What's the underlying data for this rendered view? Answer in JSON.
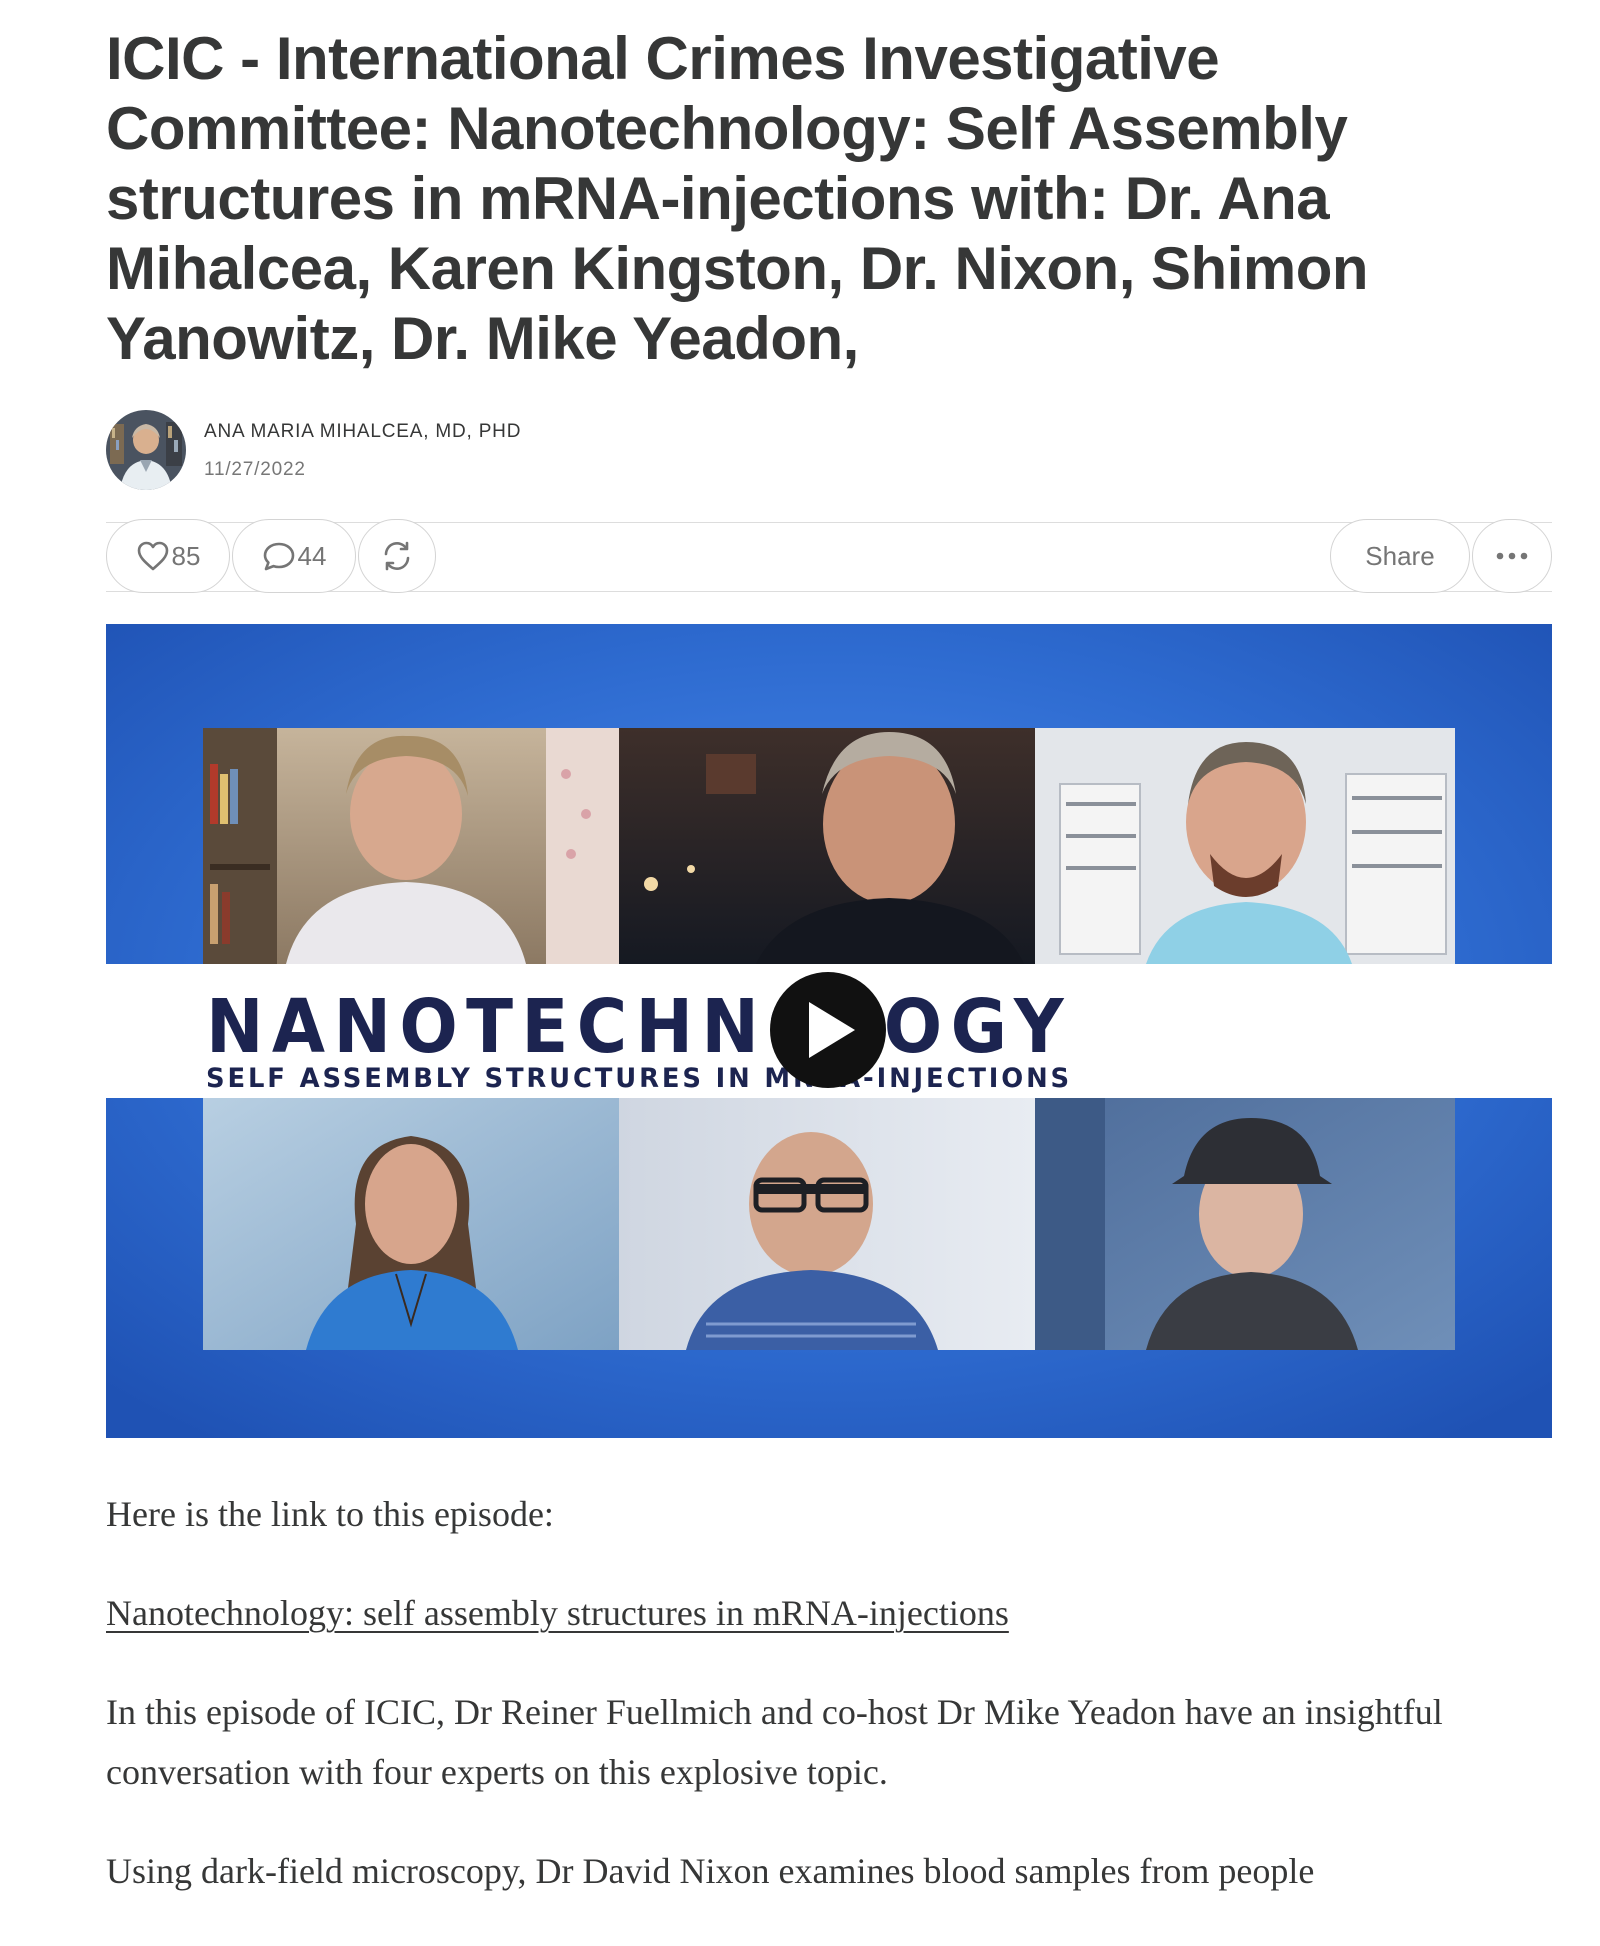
{
  "post": {
    "title": "ICIC - International Crimes Investigative Committee: Nanotechnology: Self Assembly structures in mRNA-injections with: Dr. Ana Mihalcea, Karen Kingston, Dr. Nixon, Shimon Yanowitz, Dr. Mike Yeadon,",
    "author": "ANA MARIA MIHALCEA, MD, PHD",
    "date": "11/27/2022"
  },
  "actions": {
    "likes": "85",
    "comments": "44",
    "share_label": "Share"
  },
  "video": {
    "title_text": "NANOTECHNOLOGY",
    "subtitle_text": "SELF ASSEMBLY STRUCTURES IN MRNA-INJECTIONS"
  },
  "body": {
    "intro": "Here is the link to this episode:",
    "link_text": "Nanotechnology: self assembly structures in mRNA-injections",
    "para1": "In this episode of ICIC, Dr Reiner Fuellmich and co-host Dr Mike Yeadon have an insightful conversation with four experts on this explosive topic.",
    "para2": "Using dark-field microscopy, Dr David Nixon examines blood samples from people"
  },
  "colors": {
    "text": "#363737",
    "muted": "#757575",
    "border": "#d4d4d4",
    "video_blue": "#2f6fd0",
    "title_navy": "#1c2450"
  },
  "icons": {
    "like": "heart-icon",
    "comment": "comment-bubble-icon",
    "restack": "restack-icon",
    "more": "ellipsis-icon",
    "play": "play-icon"
  }
}
